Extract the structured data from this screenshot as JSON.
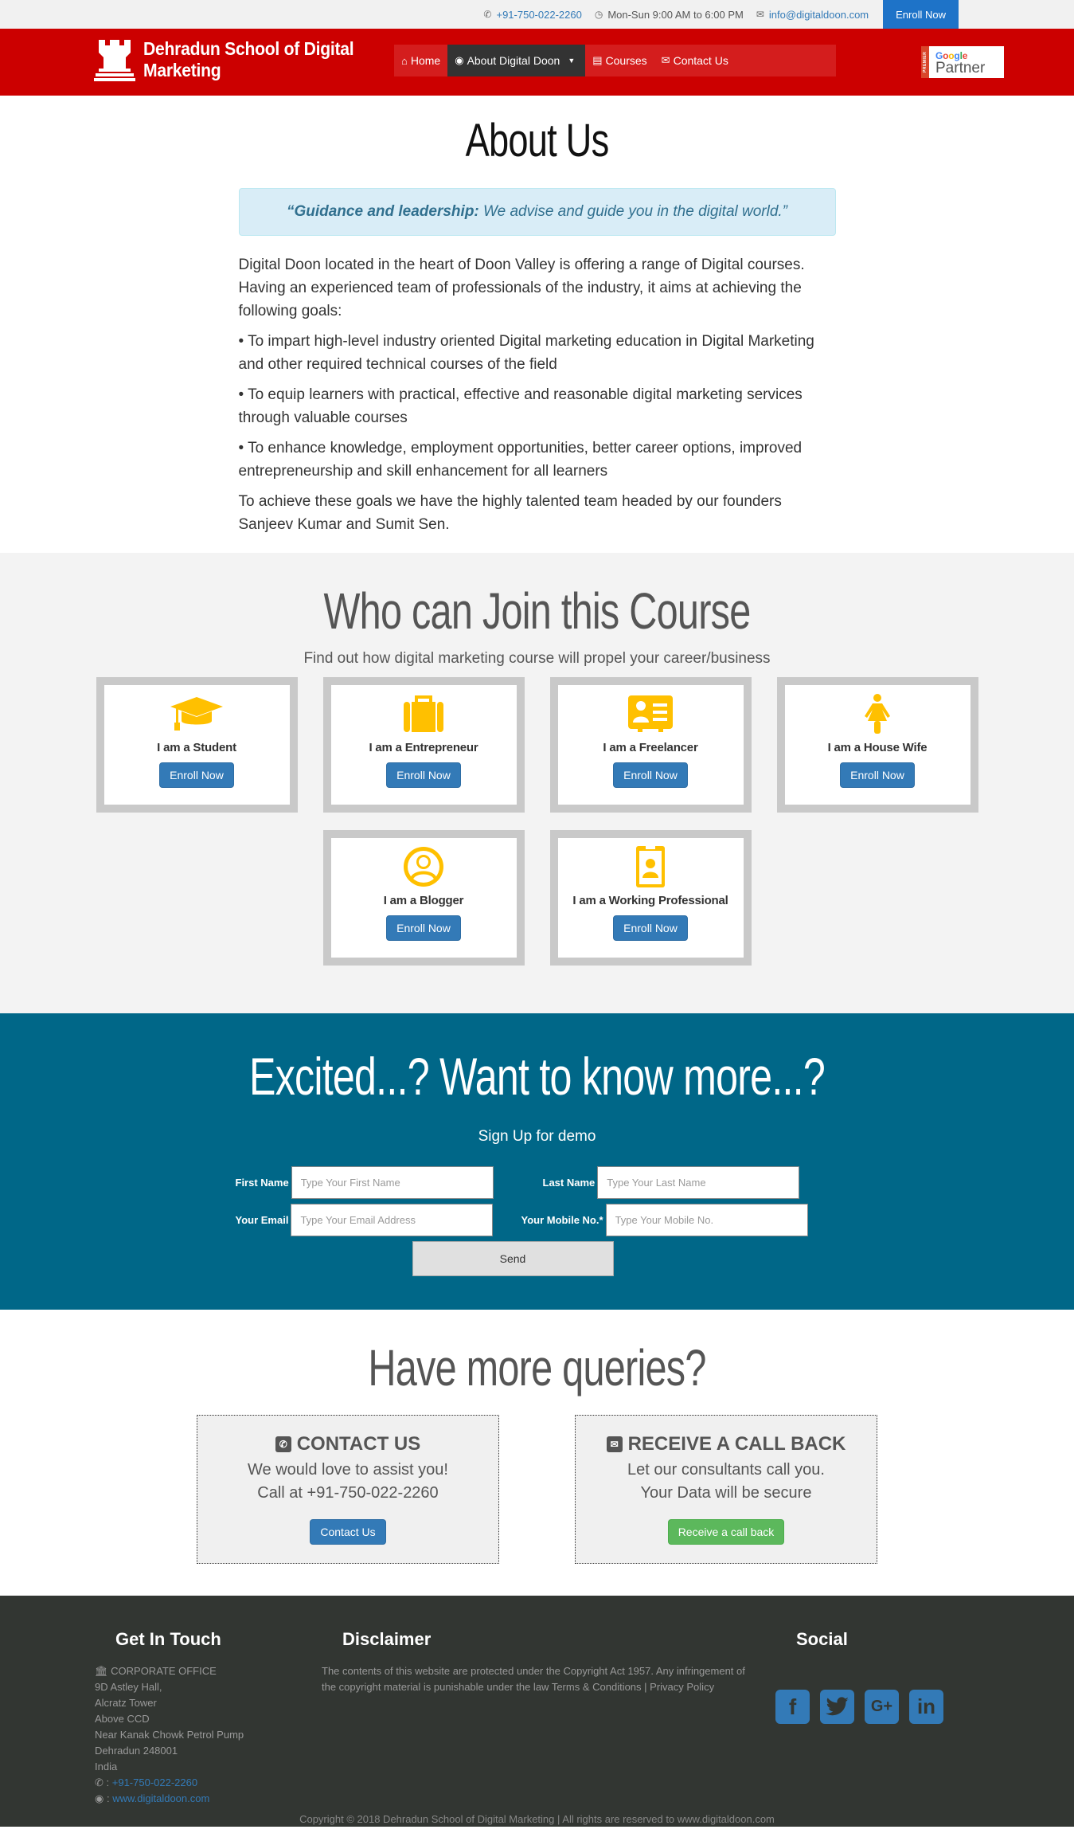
{
  "topbar": {
    "phone_icon": "phone-icon",
    "phone": "+91-750-022-2260",
    "clock_icon": "clock-icon",
    "hours": "Mon-Sun 9:00 AM to 6:00 PM",
    "mail_icon": "envelope-icon",
    "email": "info@digitaldoon.com",
    "enroll_label": "Enroll Now"
  },
  "header": {
    "logo_icon": "rook-icon",
    "site_name_line1": "Dehradun School of Digital",
    "site_name_line2": "Marketing",
    "nav": [
      {
        "icon": "⌂",
        "label": "Home"
      },
      {
        "icon": "◉",
        "label": "About Digital Doon"
      },
      {
        "icon": "▤",
        "label": "Courses"
      },
      {
        "icon": "✉",
        "label": "Contact Us"
      }
    ],
    "nav_caret": "▼",
    "badge": {
      "premier": "PREMIER",
      "google": "Google",
      "partner": "Partner"
    }
  },
  "about": {
    "title": "About Us",
    "quote_bold": "“Guidance and leadership:",
    "quote_rest": " We advise and guide you in the digital world.”",
    "paragraphs": [
      "Digital Doon located in the heart of Doon Valley is offering a range of Digital courses. Having an experienced team of professionals of the industry, it aims at achieving the following goals:",
      "• To impart high-level industry oriented Digital marketing education in Digital Marketing and other required technical courses of the field",
      "• To equip learners with practical, effective and reasonable digital marketing services through valuable courses",
      "• To enhance knowledge, employment opportunities, better career options, improved entrepreneurship and skill enhancement for all learners",
      "To achieve these goals we have the highly talented team headed by our founders Sanjeev Kumar and Sumit Sen."
    ]
  },
  "who": {
    "title": "Who can Join this Course",
    "subtitle": "Find out how digital marketing course will propel your career/business",
    "icon_color": "#ffc000",
    "cards": [
      {
        "icon": "graduation-cap-icon",
        "label": "I am a Student",
        "button": "Enroll Now"
      },
      {
        "icon": "briefcase-icon",
        "label": "I am a Entrepreneur",
        "button": "Enroll Now"
      },
      {
        "icon": "id-card-icon",
        "label": "I am a Freelancer",
        "button": "Enroll Now"
      },
      {
        "icon": "female-icon",
        "label": "I am a House Wife",
        "button": "Enroll Now"
      },
      {
        "icon": "user-circle-icon",
        "label": "I am a Blogger",
        "button": "Enroll Now"
      },
      {
        "icon": "id-badge-icon",
        "label": "I am a Working Professional",
        "button": "Enroll Now"
      }
    ]
  },
  "excited": {
    "title": "Excited...? Want to know more...?",
    "subtitle": "Sign Up for demo",
    "fields": {
      "first_name_label": "First Name",
      "first_name_placeholder": "Type Your First Name",
      "last_name_label": "Last Name",
      "last_name_placeholder": "Type Your Last Name",
      "email_label": "Your Email",
      "email_placeholder": "Type Your Email Address",
      "mobile_label": "Your Mobile No.*",
      "mobile_placeholder": "Type Your Mobile No."
    },
    "send_label": "Send"
  },
  "queries": {
    "title": "Have more queries?",
    "contact": {
      "icon": "✆",
      "title": "CONTACT US",
      "line1": "We would love to assist you!",
      "line2": "Call at +91-750-022-2260",
      "button": "Contact Us"
    },
    "callback": {
      "icon": "✉",
      "title": "RECEIVE A CALL BACK",
      "line1": "Let our consultants call you.",
      "line2": "Your Data will be secure",
      "button": "Receive a call back"
    }
  },
  "footer": {
    "get_in_touch": {
      "title": "Get In Touch",
      "office_icon": "🏛",
      "office_label": "CORPORATE OFFICE",
      "address": [
        "9D Astley Hall,",
        "Alcratz Tower",
        "Above CCD",
        "Near Kanak Chowk Petrol Pump",
        "Dehradun 248001",
        "India"
      ],
      "phone_prefix": " : ",
      "phone": "+91-750-022-2260",
      "web_prefix": " : ",
      "web": "www.digitaldoon.com"
    },
    "disclaimer": {
      "title": "Disclaimer",
      "text": "The contents of this website are protected under the Copyright Act 1957. Any infringement of the copyright material is punishable under the law ",
      "terms": "Terms & Conditions",
      "sep": " | ",
      "privacy": "Privacy Policy"
    },
    "social": {
      "title": "Social",
      "items": [
        {
          "name": "facebook",
          "glyph": "f"
        },
        {
          "name": "twitter",
          "glyph": "t"
        },
        {
          "name": "google-plus",
          "glyph": "G+"
        },
        {
          "name": "linkedin",
          "glyph": "in"
        }
      ]
    },
    "copyright": "Copyright © 2018 Dehradun School of Digital Marketing | All rights are reserved to www.digitaldoon.com"
  }
}
